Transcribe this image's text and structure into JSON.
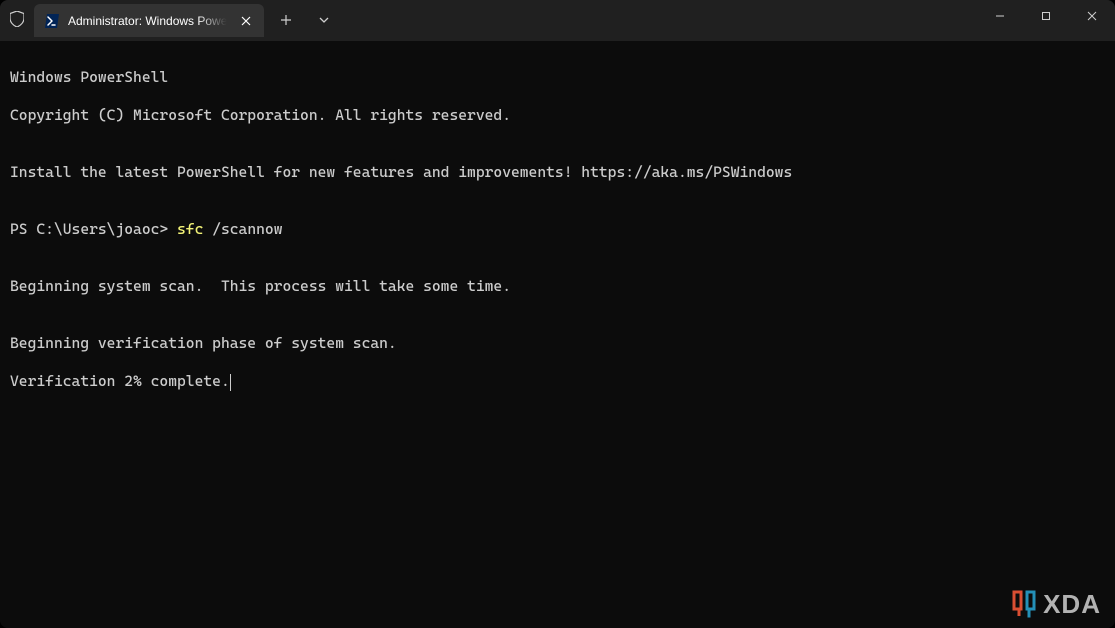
{
  "titlebar": {
    "tab_title": "Administrator: Windows PowerShell",
    "new_tab_glyph": "+",
    "dropdown_glyph": "⌄",
    "close_glyph": "✕",
    "minimize_glyph": "—",
    "maximize_glyph": "▢"
  },
  "terminal": {
    "header1": "Windows PowerShell",
    "header2": "Copyright (C) Microsoft Corporation. All rights reserved.",
    "blank": "",
    "install_msg": "Install the latest PowerShell for new features and improvements! https://aka.ms/PSWindows",
    "prompt_prefix": "PS C:\\Users\\joaoc> ",
    "prompt_cmd": "sfc",
    "prompt_args": " /scannow",
    "scan_begin": "Beginning system scan.  This process will take some time.",
    "verify_begin": "Beginning verification phase of system scan.",
    "verify_progress": "Verification 2% complete."
  },
  "watermark": {
    "text": "XDA"
  }
}
